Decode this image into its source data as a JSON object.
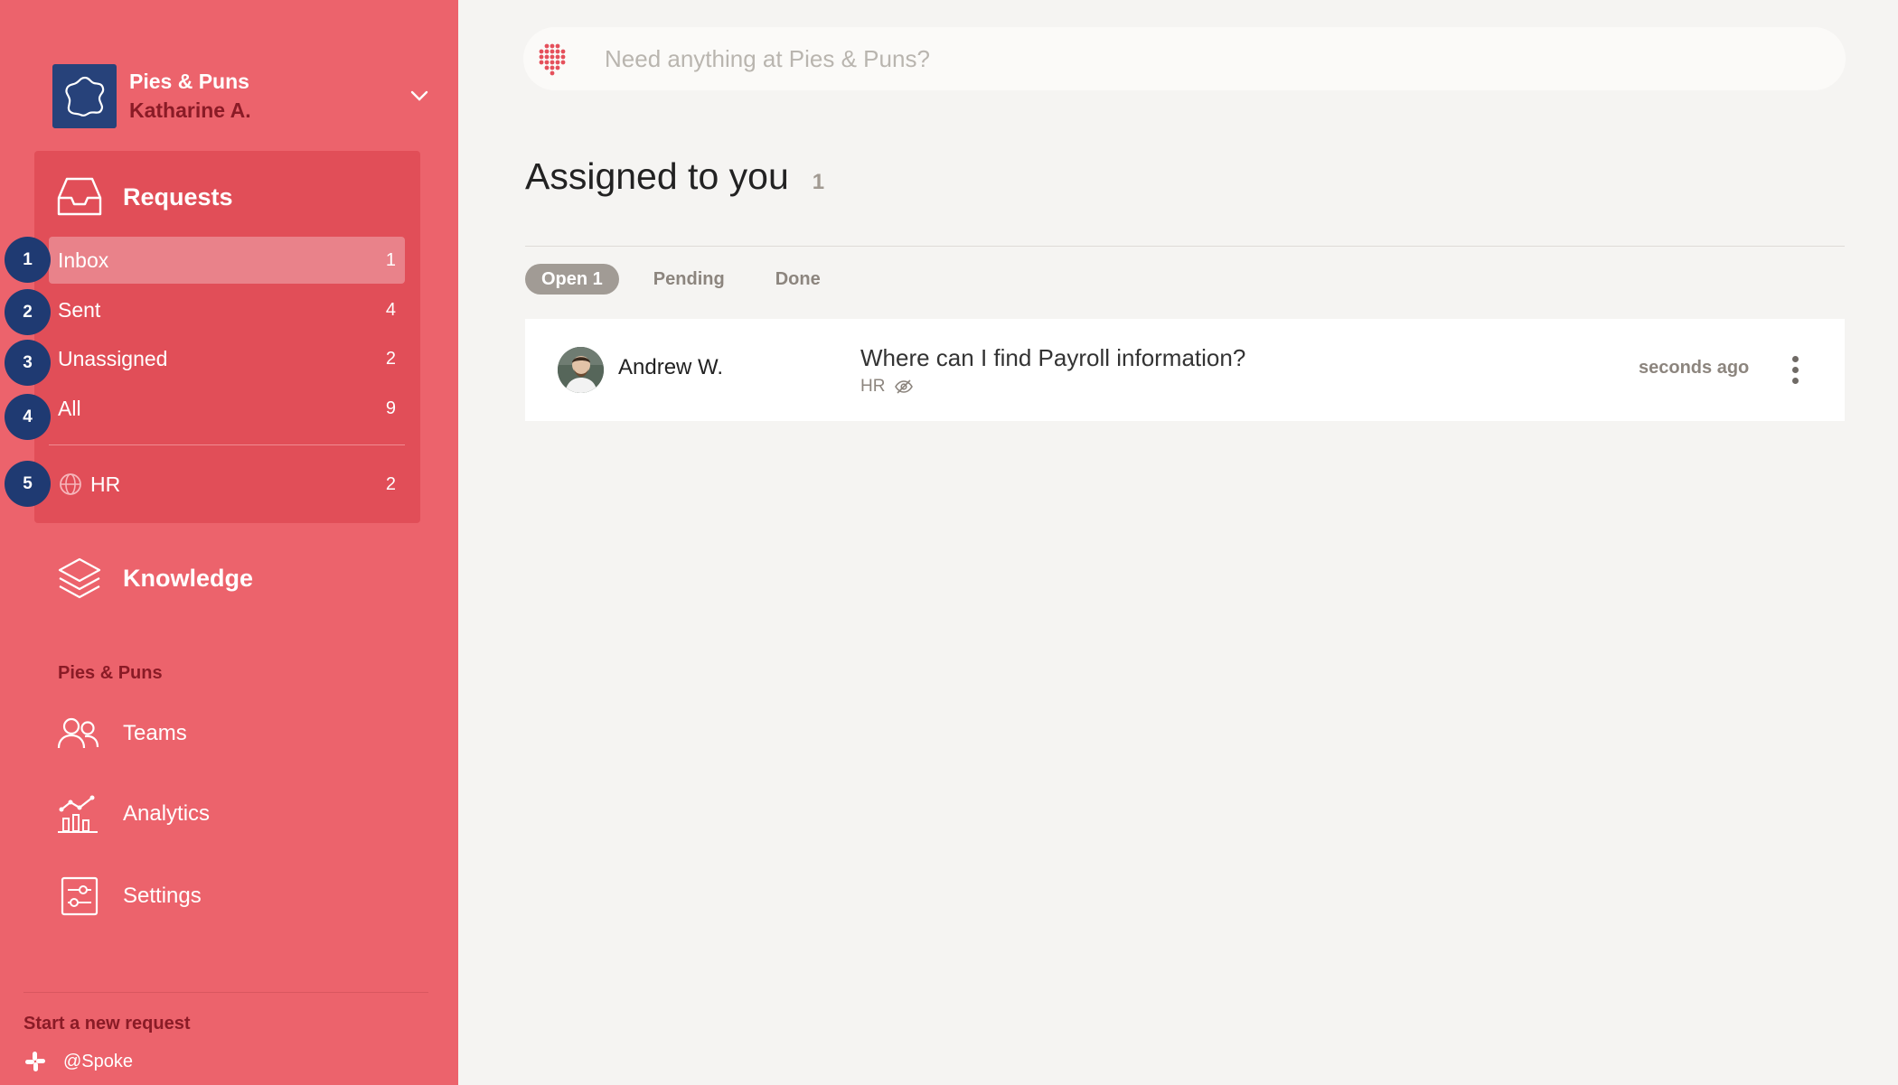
{
  "workspace": {
    "name": "Pies & Puns",
    "user": "Katharine A."
  },
  "search": {
    "placeholder": "Need anything at Pies & Puns?"
  },
  "requests": {
    "label": "Requests",
    "items": [
      {
        "label": "Inbox",
        "count": "1"
      },
      {
        "label": "Sent",
        "count": "4"
      },
      {
        "label": "Unassigned",
        "count": "2"
      },
      {
        "label": "All",
        "count": "9"
      }
    ],
    "teams": [
      {
        "label": "HR",
        "count": "2"
      }
    ]
  },
  "badges": [
    "1",
    "2",
    "3",
    "4",
    "5"
  ],
  "knowledge": {
    "label": "Knowledge"
  },
  "org_section": {
    "label": "Pies & Puns",
    "links": [
      {
        "label": "Teams",
        "icon": "people-icon"
      },
      {
        "label": "Analytics",
        "icon": "analytics-icon"
      },
      {
        "label": "Settings",
        "icon": "sliders-icon"
      }
    ]
  },
  "footer": {
    "start_label": "Start a new request",
    "slack_handle": "@Spoke"
  },
  "main": {
    "title": "Assigned to you",
    "title_count": "1",
    "tabs": [
      {
        "label": "Open 1",
        "active": true
      },
      {
        "label": "Pending"
      },
      {
        "label": "Done"
      }
    ],
    "tickets": [
      {
        "requester": "Andrew W.",
        "title": "Where can I find Payroll information?",
        "team": "HR",
        "time": "seconds ago"
      }
    ]
  },
  "colors": {
    "sidebar": "#ec636c",
    "panel": "#e14e58",
    "badge": "#1f3a72",
    "accent_dark": "#8a1b26"
  }
}
